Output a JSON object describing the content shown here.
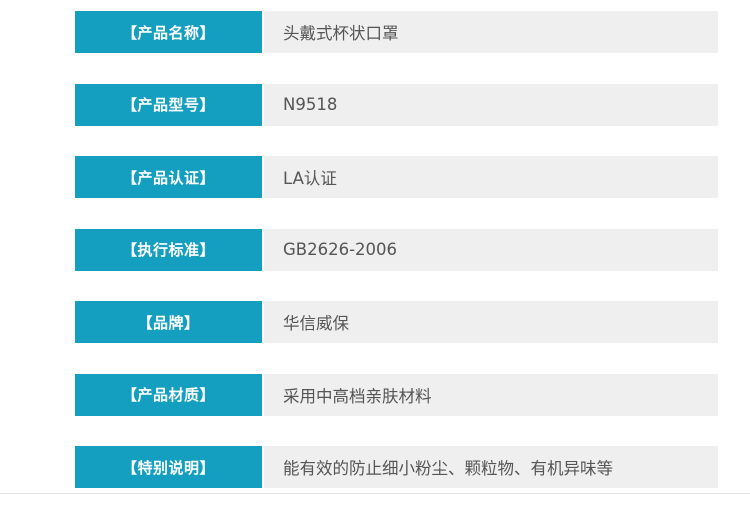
{
  "specs": [
    {
      "label": "【产品名称】",
      "value": "头戴式杯状口罩"
    },
    {
      "label": "【产品型号】",
      "value": "N9518"
    },
    {
      "label": "【产品认证】",
      "value": "LA认证"
    },
    {
      "label": "【执行标准】",
      "value": "GB2626-2006"
    },
    {
      "label": "【品牌】",
      "value": "华信威保"
    },
    {
      "label": "【产品材质】",
      "value": "采用中高档亲肤材料"
    },
    {
      "label": "【特别说明】",
      "value": "能有效的防止细小粉尘、颗粒物、有机异味等"
    }
  ],
  "colors": {
    "label_bg": "#149fc1",
    "label_text": "#ffffff",
    "value_bg": "#efefef",
    "value_text": "#555555"
  }
}
